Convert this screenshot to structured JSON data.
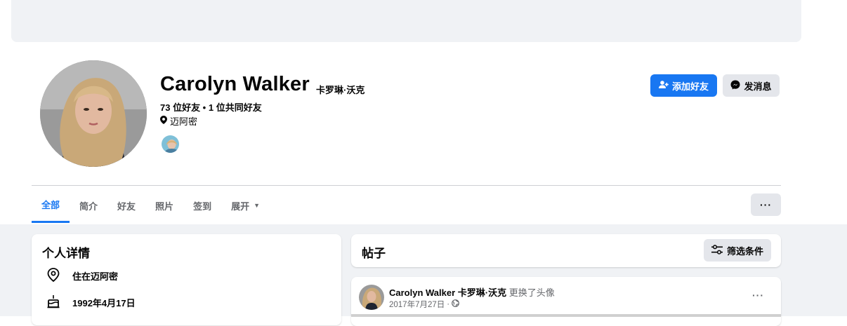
{
  "profile": {
    "name": "Carolyn Walker",
    "alt_name": "卡罗琳·沃克",
    "friends_summary": "73 位好友 • 1 位共同好友",
    "location": "迈阿密"
  },
  "actions": {
    "add_friend": "添加好友",
    "message": "发消息",
    "more": "···"
  },
  "tabs": [
    {
      "label": "全部",
      "active": true
    },
    {
      "label": "简介"
    },
    {
      "label": "好友"
    },
    {
      "label": "照片"
    },
    {
      "label": "签到"
    },
    {
      "label": "展开"
    }
  ],
  "details": {
    "title": "个人详情",
    "lives_in": "住在迈阿密",
    "birthday": "1992年4月17日"
  },
  "posts": {
    "title": "帖子",
    "filter_label": "筛选条件",
    "post": {
      "author": "Carolyn Walker",
      "alt_name": "卡罗琳·沃克",
      "action": "更换了头像",
      "date": "2017年7月27日",
      "separator": "·",
      "more": "···"
    }
  },
  "colors": {
    "accent": "#1877f2",
    "secondary_button": "#e4e6eb",
    "page_bg": "#f0f2f5",
    "muted_text": "#65676b"
  }
}
